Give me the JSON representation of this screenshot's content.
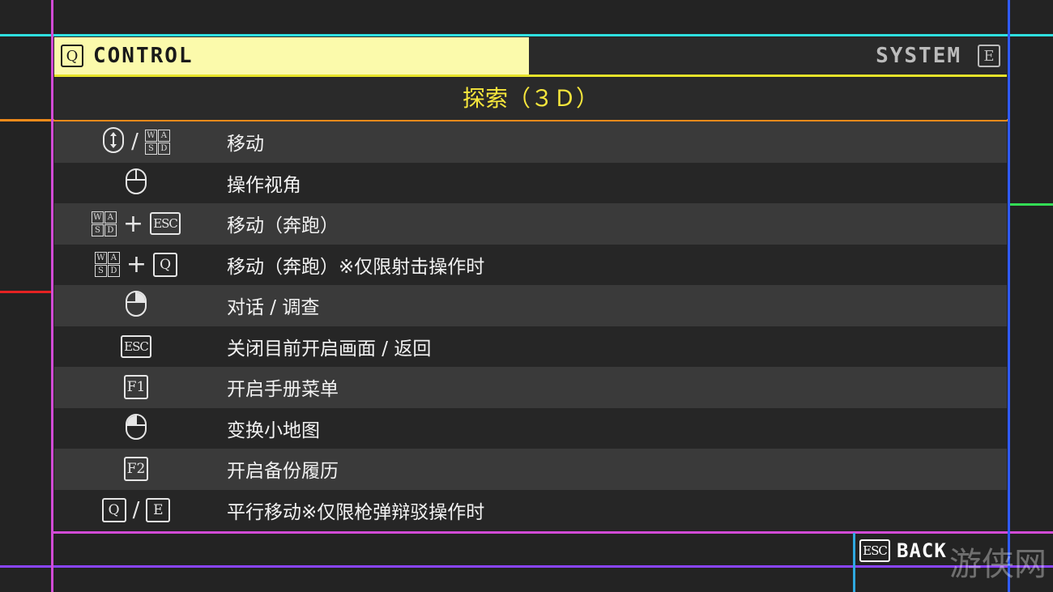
{
  "header": {
    "control_key": "Q",
    "control_label": "CONTROL",
    "system_label": "SYSTEM",
    "system_key": "E"
  },
  "section_title": "探索（３Ｄ）",
  "rows": [
    {
      "icons": [
        "mouse-wheel-icon",
        "/",
        "wasd-icon"
      ],
      "label": "移动"
    },
    {
      "icons": [
        "mouse-icon"
      ],
      "label": "操作视角"
    },
    {
      "icons": [
        "wasd-icon",
        "+",
        "ESC"
      ],
      "label": "移动（奔跑）"
    },
    {
      "icons": [
        "wasd-icon",
        "+",
        "Q"
      ],
      "label": "移动（奔跑）※仅限射击操作时"
    },
    {
      "icons": [
        "mouse-right-click-icon"
      ],
      "label": "对话 / 调查"
    },
    {
      "icons": [
        "ESC"
      ],
      "label": "关闭目前开启画面 / 返回"
    },
    {
      "icons": [
        "F1"
      ],
      "label": "开启手册菜单"
    },
    {
      "icons": [
        "mouse-left-click-icon"
      ],
      "label": "变换小地图"
    },
    {
      "icons": [
        "F2"
      ],
      "label": "开启备份履历"
    },
    {
      "icons": [
        "Q",
        "/",
        "E"
      ],
      "label": "平行移动※仅限枪弹辩驳操作时"
    }
  ],
  "footer": {
    "back_key": "ESC",
    "back_label": "BACK"
  },
  "watermark": "游侠网",
  "colors": {
    "active_tab": "#fbfaab",
    "section_title": "#f6e63c",
    "neon_cyan": "#2fe0e0",
    "neon_magenta": "#d24bd6",
    "neon_orange": "#f08a1a",
    "neon_yellow": "#e6e22a",
    "neon_blue": "#2f5bff",
    "neon_green": "#33dd55",
    "neon_red": "#e52222",
    "neon_purple": "#8a45ff"
  }
}
